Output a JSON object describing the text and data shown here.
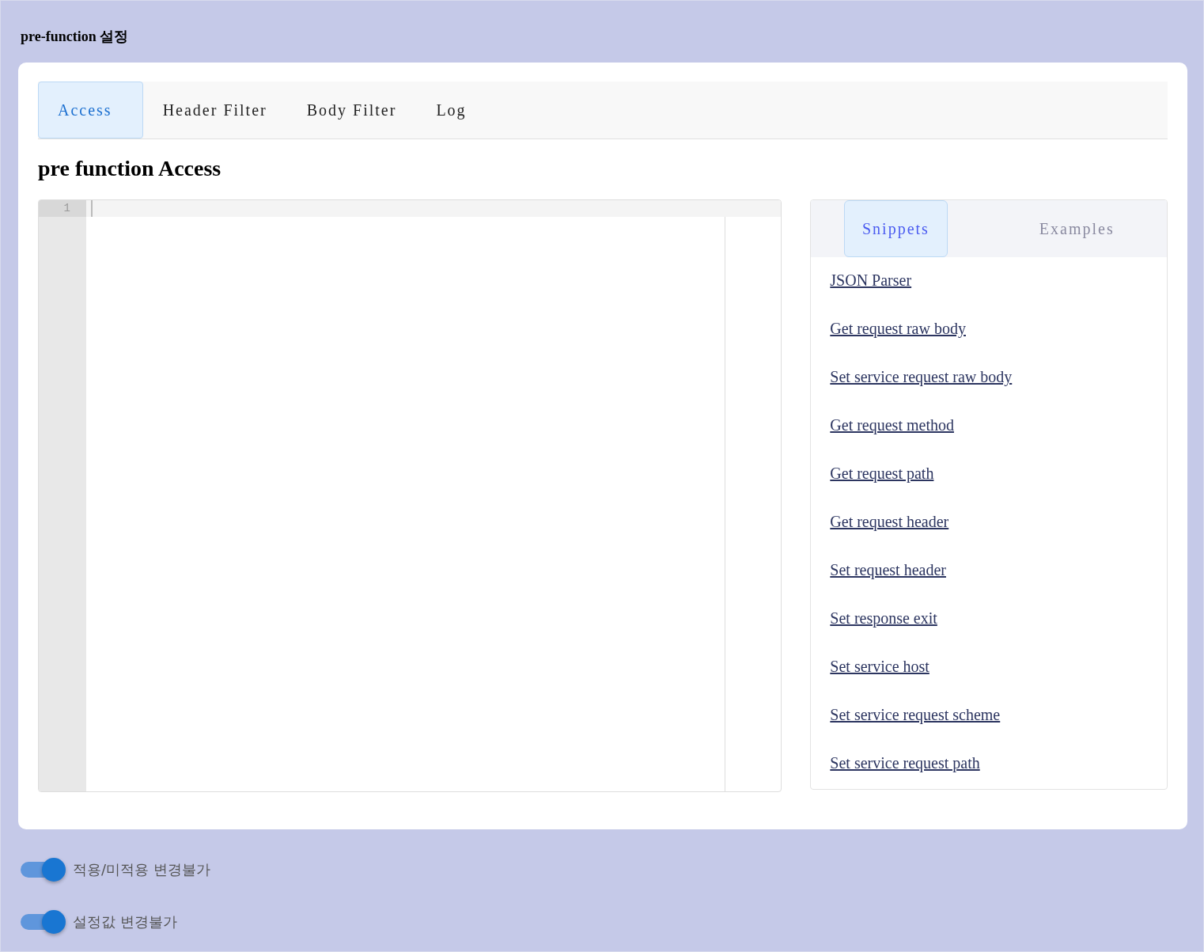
{
  "page_title": "pre-function 설정",
  "tabs": [
    {
      "label": "Access",
      "selected": true
    },
    {
      "label": "Header Filter",
      "selected": false
    },
    {
      "label": "Body Filter",
      "selected": false
    },
    {
      "label": "Log",
      "selected": false
    }
  ],
  "section_title": "pre function Access",
  "editor": {
    "line_numbers": [
      "1"
    ]
  },
  "side_tabs": [
    {
      "label": "Snippets",
      "selected": true
    },
    {
      "label": "Examples",
      "selected": false
    }
  ],
  "snippets": [
    "JSON Parser",
    "Get request raw body",
    "Set service request raw body",
    "Get request method",
    "Get request path",
    "Get request header",
    "Set request header",
    "Set response exit",
    "Set service host",
    "Set service request scheme",
    "Set service request path"
  ],
  "toggles": [
    {
      "label": "적용/미적용 변경불가",
      "on": true
    },
    {
      "label": "설정값 변경불가",
      "on": true
    }
  ]
}
